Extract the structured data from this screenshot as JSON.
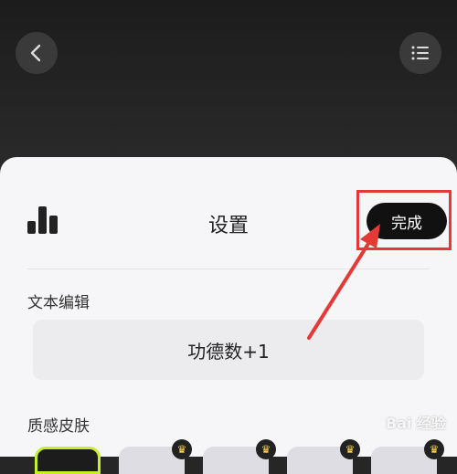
{
  "header": {
    "back_icon": "chevron-left-icon",
    "menu_icon": "list-menu-icon"
  },
  "sheet": {
    "title": "设置",
    "done_label": "完成",
    "stats_icon": "bar-chart-icon",
    "text_edit_label": "文本编辑",
    "text_value": "功德数+1",
    "skin_label": "质感皮肤",
    "skins": [
      {
        "selected": true,
        "premium": false
      },
      {
        "selected": false,
        "premium": true
      },
      {
        "selected": false,
        "premium": true
      },
      {
        "selected": false,
        "premium": true
      },
      {
        "selected": false,
        "premium": true
      }
    ]
  },
  "annotation": {
    "color": "#e53935"
  },
  "watermark": "Bai 经验",
  "colors": {
    "accent_selected_border": "#c8ee2a",
    "done_button": "#111111"
  }
}
